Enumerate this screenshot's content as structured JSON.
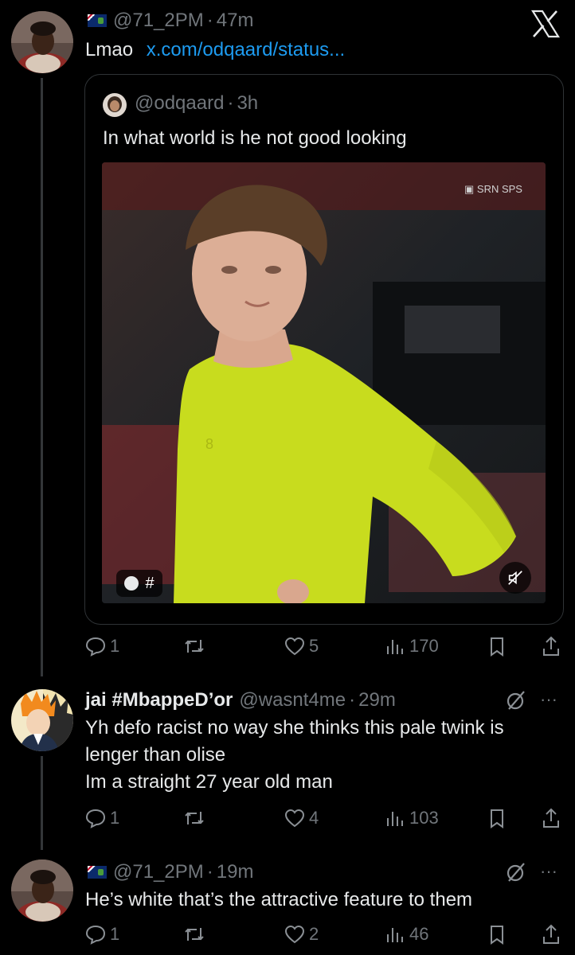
{
  "tweet1": {
    "handle": "@71_2PM",
    "sep": "·",
    "time": "47m",
    "text": "Lmao",
    "link": "x.com/odqaard/status...",
    "quote": {
      "handle": "@odqaard",
      "sep": "·",
      "time": "3h",
      "text": "In what world is he not good looking",
      "video_badge": "#"
    },
    "actions": {
      "replies": "1",
      "retweets": "",
      "likes": "5",
      "views": "170"
    }
  },
  "tweet2": {
    "display_name": "jai #MbappeD’or",
    "handle": "@wasnt4me",
    "sep": "·",
    "time": "29m",
    "line1": "Yh defo racist no way she thinks this pale twink is",
    "line2": "lenger than olise",
    "line3": "Im a straight 27 year old man",
    "actions": {
      "replies": "1",
      "retweets": "",
      "likes": "4",
      "views": "103"
    }
  },
  "tweet3": {
    "handle": "@71_2PM",
    "sep": "·",
    "time": "19m",
    "text": "He’s white that’s the attractive feature to them",
    "actions": {
      "replies": "1",
      "retweets": "",
      "likes": "2",
      "views": "46"
    }
  },
  "more_label": "···",
  "colors": {
    "bg": "#000000",
    "text": "#e7e9ea",
    "muted": "#71767b",
    "link": "#1d9bf0",
    "border": "#2f3336",
    "jersey": "#c8dc1e"
  }
}
